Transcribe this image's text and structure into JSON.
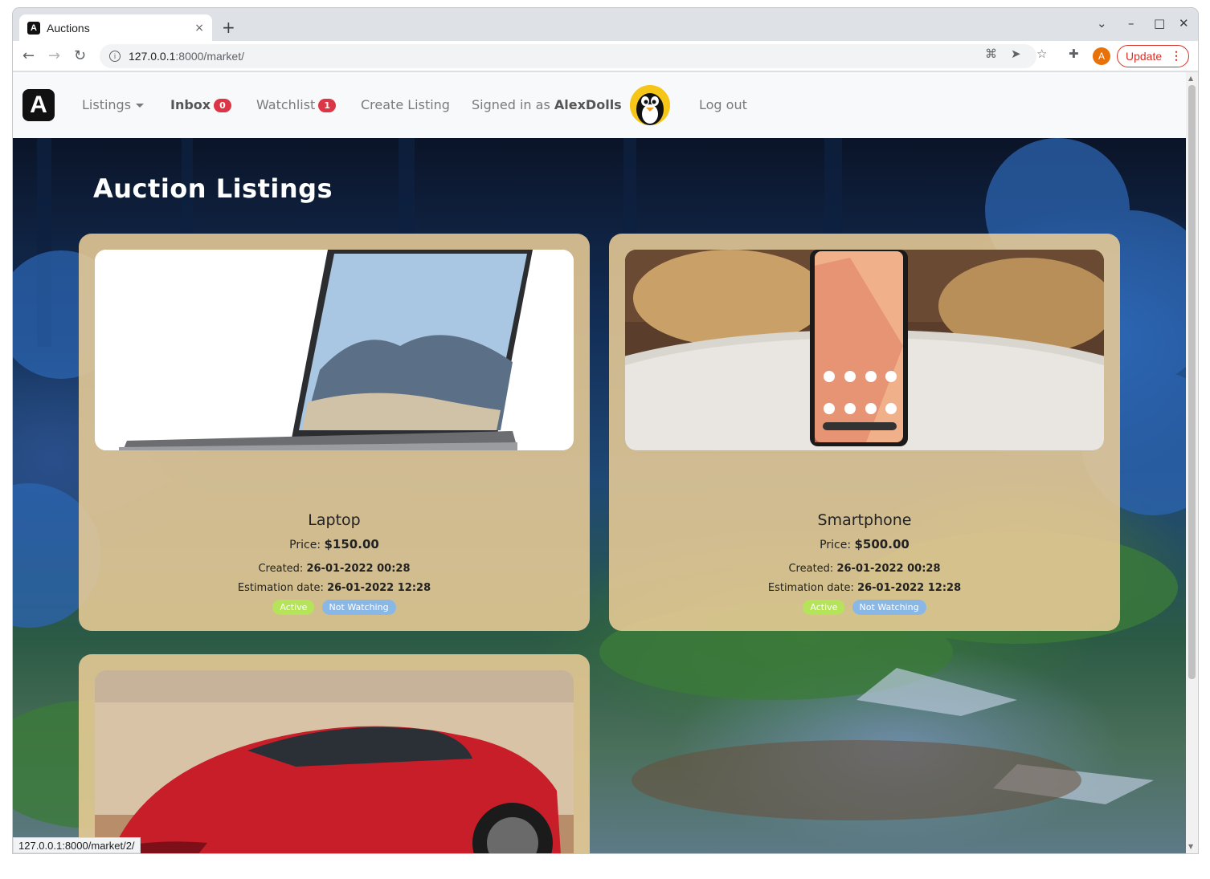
{
  "browser": {
    "tab_title": "Auctions",
    "tab_close": "×",
    "new_tab": "+",
    "url_host": "127.0.0.1",
    "url_rest": ":8000/market/",
    "update_label": "Update",
    "profile_initial": "A",
    "status_url": "127.0.0.1:8000/market/2/"
  },
  "nav": {
    "brand": "A",
    "listings": "Listings",
    "inbox": "Inbox",
    "inbox_count": "0",
    "watchlist": "Watchlist",
    "watchlist_count": "1",
    "create_listing": "Create Listing",
    "signed_in_prefix": "Signed in as",
    "username": "AlexDolls",
    "logout": "Log out"
  },
  "page": {
    "title": "Auction Listings"
  },
  "listings": [
    {
      "name": "Laptop",
      "price_label": "Price:",
      "price": "$150.00",
      "created_label": "Created:",
      "created": "26-01-2022 00:28",
      "estimation_label": "Estimation date:",
      "estimation": "26-01-2022 12:28",
      "status": "Active",
      "watch": "Not Watching"
    },
    {
      "name": "Smartphone",
      "price_label": "Price:",
      "price": "$500.00",
      "created_label": "Created:",
      "created": "26-01-2022 00:28",
      "estimation_label": "Estimation date:",
      "estimation": "26-01-2022 12:28",
      "status": "Active",
      "watch": "Not Watching"
    }
  ],
  "colors": {
    "badge_red": "#dc3545",
    "active_green": "#b5e35a",
    "watch_blue": "#8ab8e6",
    "card_bg": "#e9cc96"
  }
}
